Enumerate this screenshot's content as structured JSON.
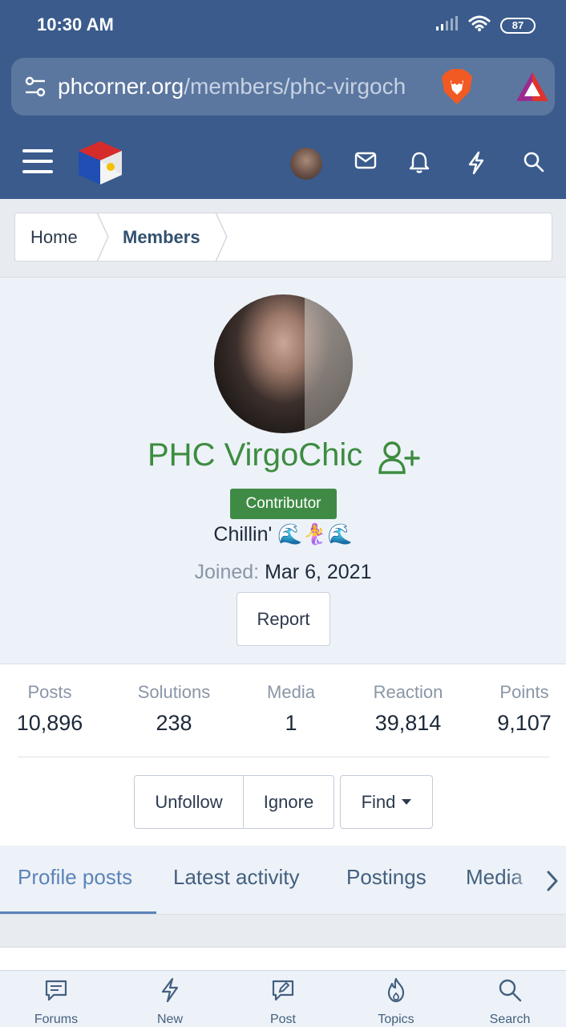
{
  "statusbar": {
    "time": "10:30 AM",
    "battery": "87"
  },
  "browser": {
    "url_host": "phcorner.org",
    "url_path": "/members/phc-virgoch"
  },
  "breadcrumb": {
    "home": "Home",
    "members": "Members"
  },
  "profile": {
    "username": "PHC VirgoChic",
    "badge": "Contributor",
    "status": "Chillin' 🌊🧜‍♀️🌊",
    "joined_label": "Joined:",
    "joined_date": "Mar 6, 2021",
    "report": "Report"
  },
  "stats": [
    {
      "label": "Posts",
      "value": "10,896"
    },
    {
      "label": "Solutions",
      "value": "238"
    },
    {
      "label": "Media",
      "value": "1"
    },
    {
      "label": "Reaction",
      "value": "39,814"
    },
    {
      "label": "Points",
      "value": "9,107"
    }
  ],
  "actions": {
    "unfollow": "Unfollow",
    "ignore": "Ignore",
    "find": "Find"
  },
  "tabs": [
    "Profile posts",
    "Latest activity",
    "Postings",
    "Media"
  ],
  "bottom_nav": [
    "Forums",
    "New",
    "Post",
    "Topics",
    "Search"
  ],
  "colors": {
    "header": "#3a5b8c",
    "username": "#3d8c40",
    "badge": "#3f8b46",
    "active_tab": "#5b84b8"
  }
}
